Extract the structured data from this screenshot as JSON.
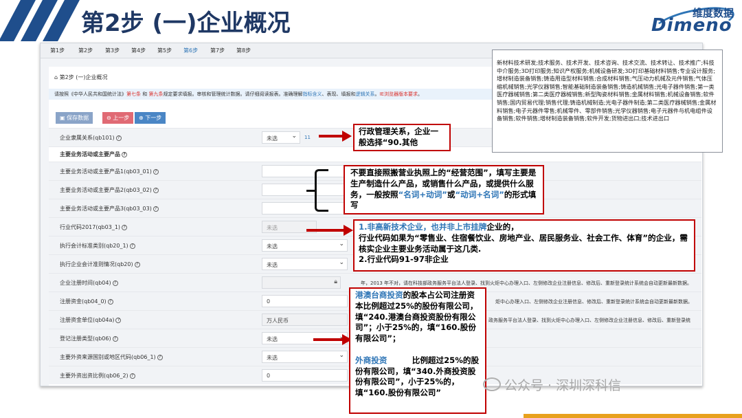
{
  "slide": {
    "title": "第2步  (一)企业概况",
    "logo_cn": "维度数据",
    "logo_en": "Dimeno"
  },
  "app": {
    "steps": [
      "第1步",
      "第2步",
      "第3步",
      "第4步",
      "第5步",
      "第6步",
      "第7步",
      "第8步"
    ],
    "active_step": "第6步",
    "breadcrumb": "第2步 (一)企业概况",
    "notice": {
      "p1": "请按照《中华人民共和国统计法》",
      "s7": "第七条",
      "and": "和",
      "s9": "第九条",
      "p2": "规定要求填报。审核和管理统计数据。请仔细阅读报表。准确理解",
      "l1": "指标含义",
      "p3": "、表现、填报和",
      "l2": "逻辑关系",
      "p4": "。",
      "l3": "IE浏览器版本要求",
      "p5": "。"
    },
    "buttons": {
      "save": "保存数据",
      "prev": "上一步",
      "next": "下一步"
    },
    "rows": [
      {
        "label": "企业隶属关系(qb101)",
        "value": "未选",
        "extra": "11"
      },
      {
        "label": "主要业务活动或主要产品"
      },
      {
        "label": "主要业务活动或主要产品1(qb03_01)"
      },
      {
        "label": "主要业务活动或主要产品2(qb03_02)"
      },
      {
        "label": "主要业务活动或主要产品3(qb03_03)"
      },
      {
        "label": "行业代码2017(qb03_1)",
        "value": "未选"
      },
      {
        "label": "执行会计标准类别(qb20_1)",
        "value": "未选"
      },
      {
        "label": "执行企业会计准则情况(qb20)",
        "value": "未选"
      },
      {
        "label": "企业注册时间(qb04)",
        "hint": "年，2013 年不对，请在科技部政务服务平台法人登录、找到火炬中心办理入口、左侧修改企业注册信息、修改后、重新登录统计系统会自动更新最新数据。"
      },
      {
        "label": "注册资金(qb04_0)",
        "value": "0",
        "hint": "炬中心办理入口、左侧修改企业注册信息、修改后、重新登录统计系统会自动更新最新数据。"
      },
      {
        "label": "注册资金单位(qb04a)",
        "value": "万人民币",
        "hint": "政务服务平台法人登录、找到火炬中心办理入口、左侧修改企业注册信息、修改后、重新登录统"
      },
      {
        "label": "登记注册类型(qb06)",
        "value": "未选"
      },
      {
        "label": "主要外资来源国别或地区代码(qb06_1)",
        "value": "未选"
      },
      {
        "label": "主要外资出资比例(qb06_2)",
        "value": "0"
      }
    ]
  },
  "right_box": "新材料技术研发;技术服务、技术开发、技术咨询、技术交流、技术转让、技术推广;科技中介服务;3D打印服务;知识产权服务;机械设备研发;3D打印基础材料销售;专业设计服务;增材制造装备销售;铸造用造型材料销售;合成材料销售;气压动力机械及元件销售;气体压缩机械销售;光学仪器销售;智能基础制造装备销售;铸造机械销售;光电子器件销售;第一类医疗器械销售;第二类医疗器械销售;新型陶瓷材料销售;金属材料销售;机械设备销售;软件销售;国内贸易代理;销售代理;铸造机械制造;光电子器件制造;第二类医疗器械销售;金属材料销售;电子元器件零售;机械零件、零部件销售;光学仪器销售;电子元器件与机电组件设备销售;软件销售;增材制造装备销售;软件开发;货物进出口;技术进出口",
  "callouts": {
    "c1": "行政管理关系，企业一般选择“90.其他",
    "c2a": "不要直接照搬营业执照上的“经营范围”，填写主要是生产制造什么产品，或销售什么产品，或提供什么服务，一般按照",
    "c2b": "“名词+动词”",
    "c2c": "或",
    "c2d": "“动词+名词”",
    "c2e": "的形式填写",
    "c3a": "1.非高新技术企业，也并",
    "c3b": "非上市挂牌",
    "c3c": "企业的，",
    "c3d": "行业代码如果为“零售业、住宿餐饮业、房地产业、居民服务业、社会工作、体育”的企业，需核实企业主要业务活动属于这几类.",
    "c3e": "2.行业代码91-97非企业",
    "c4a": "港澳台商投资",
    "c4b": "的股本占公司注册资本比例超过25%的股份有限公司，填“240.港澳台商投资股份有限公司”；小于25%的，填“160.股份有限公司”；",
    "c4c": "外商投资",
    "c4d": "比例超过25%的股份有限公司，填“340.外商投资股份有限公司”，小于25%的，填“160.股份有限公司”"
  },
  "watermark": "公众号 · 深圳深科信",
  "colors": {
    "title": "#1f3864",
    "accent": "#c00000",
    "link": "#2e75b6"
  }
}
